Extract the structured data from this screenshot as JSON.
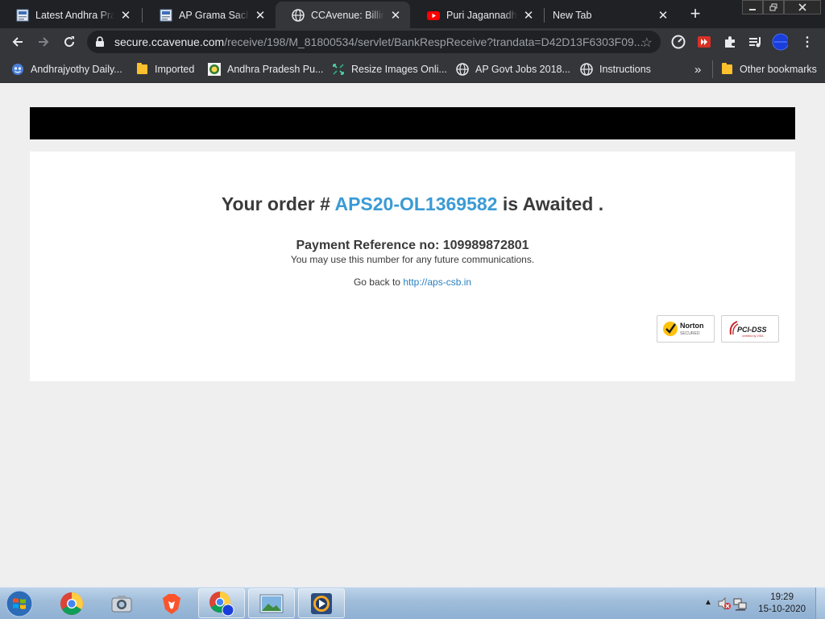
{
  "tabs": [
    {
      "title": "Latest Andhra Prade",
      "favicon": "news-icon",
      "active": false
    },
    {
      "title": "AP Grama Sachivala",
      "favicon": "news-icon",
      "active": false
    },
    {
      "title": "CCAvenue: Billing S",
      "favicon": "globe-icon",
      "active": true
    },
    {
      "title": "Puri Jagannadh, Ka",
      "favicon": "youtube-icon",
      "active": false
    },
    {
      "title": "New Tab",
      "favicon": "",
      "active": false
    }
  ],
  "omnibox": {
    "host": "secure.ccavenue.com",
    "path": "/receive/198/M_81800534/servlet/BankRespReceive?trandata=D42D13F6303F09..."
  },
  "bookmarks": [
    {
      "label": "Andhrajyothy Daily...",
      "icon": "andhrajyothy-icon"
    },
    {
      "label": "Imported",
      "icon": "folder-icon"
    },
    {
      "label": "Andhra Pradesh Pu...",
      "icon": "ap-emblem-icon"
    },
    {
      "label": "Resize Images Onli...",
      "icon": "resize-icon"
    },
    {
      "label": "AP Govt Jobs 2018...",
      "icon": "globe-icon"
    },
    {
      "label": "Instructions",
      "icon": "globe-icon"
    }
  ],
  "bookmarks_overflow": "»",
  "other_bookmarks": "Other bookmarks",
  "order": {
    "prefix": "Your order #",
    "id": "APS20-OL1369582",
    "suffix": "is Awaited ."
  },
  "payment": {
    "reference_label": "Payment Reference no: 109989872801",
    "note": "You may use this number for any future communications."
  },
  "goback": {
    "text": "Go back to",
    "link": "http://aps-csb.in"
  },
  "badges": {
    "norton_title": "Norton",
    "norton_sub": "SECURED",
    "pci_title": "PCI-DSS",
    "pci_sub": "certified by VISA"
  },
  "taskbar": {
    "time": "19:29",
    "date": "15-10-2020"
  },
  "colors": {
    "order_id": "#3a9bd5",
    "link": "#2a80c0",
    "tab_bg": "#202124",
    "toolbar_bg": "#35363a"
  }
}
